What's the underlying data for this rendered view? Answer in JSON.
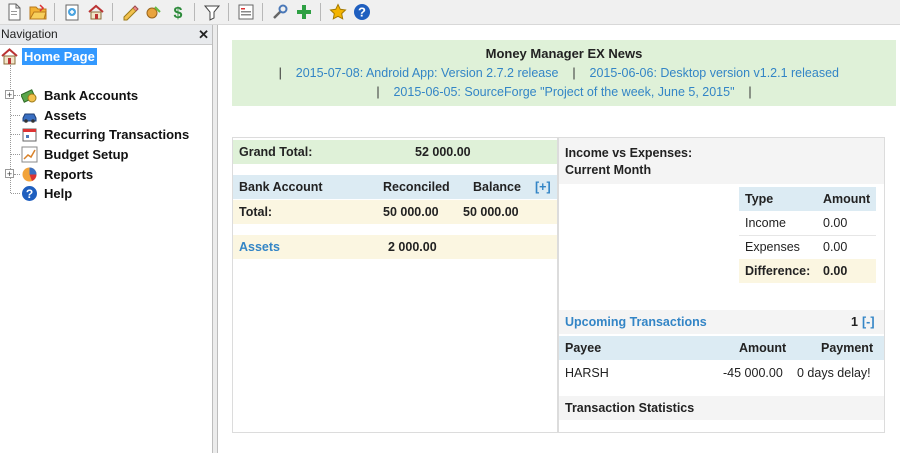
{
  "toolbar": {
    "icons": [
      "new-database-icon",
      "open-database-icon",
      "new-transaction-icon",
      "home-page-icon",
      "organize-payees-icon",
      "organize-categories-icon",
      "currency-icon",
      "filter-icon",
      "reports-icon",
      "options-icon",
      "add-icon",
      "favorite-icon",
      "help-icon"
    ]
  },
  "navigation": {
    "title": "Navigation",
    "close": "✕",
    "items": [
      {
        "label": "Home Page",
        "icon": "home-icon"
      },
      {
        "label": "Bank Accounts",
        "icon": "money-icon"
      },
      {
        "label": "Assets",
        "icon": "car-icon"
      },
      {
        "label": "Recurring Transactions",
        "icon": "calendar-icon"
      },
      {
        "label": "Budget Setup",
        "icon": "chart-icon"
      },
      {
        "label": "Reports",
        "icon": "pie-chart-icon"
      },
      {
        "label": "Help",
        "icon": "help-icon"
      }
    ]
  },
  "news": {
    "title": "Money Manager EX News",
    "sep": "|",
    "items": [
      "2015-07-08: Android App: Version 2.7.2 release",
      "2015-06-06: Desktop version v1.2.1 released",
      "2015-06-05: SourceForge \"Project of the week, June 5, 2015\""
    ]
  },
  "summary": {
    "grand_total_label": "Grand Total:",
    "grand_total_value": "52 000.00",
    "bank": {
      "col_account": "Bank Account",
      "col_reconciled": "Reconciled",
      "col_balance": "Balance",
      "toggle": "[+]",
      "total_label": "Total:",
      "total_reconciled": "50 000.00",
      "total_balance": "50 000.00"
    },
    "assets_label": "Assets",
    "assets_value": "2 000.00"
  },
  "income_expenses": {
    "title_line1": "Income vs Expenses:",
    "title_line2": "Current Month",
    "col_type": "Type",
    "col_amount": "Amount",
    "rows": [
      {
        "type": "Income",
        "amount": "0.00"
      },
      {
        "type": "Expenses",
        "amount": "0.00"
      }
    ],
    "difference_label": "Difference:",
    "difference_value": "0.00"
  },
  "upcoming": {
    "title": "Upcoming Transactions",
    "count": "1",
    "toggle": "[-]",
    "col_payee": "Payee",
    "col_amount": "Amount",
    "col_payment": "Payment",
    "rows": [
      {
        "payee": "HARSH",
        "amount": "-45 000.00",
        "payment": "0 days delay!"
      }
    ]
  },
  "stats": {
    "title": "Transaction Statistics"
  },
  "colors": {
    "accent_link": "#3385c6",
    "news_bg": "#dff1d8",
    "header_blue": "#dcebf3",
    "row_cream": "#fbf6e1",
    "selected": "#3399ff"
  }
}
